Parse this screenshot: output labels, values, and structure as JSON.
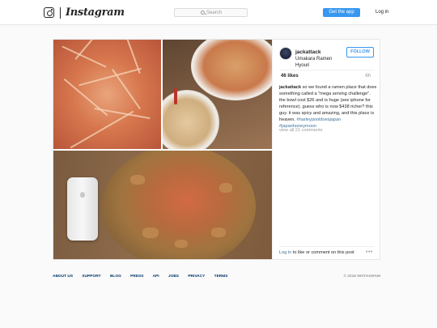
{
  "header": {
    "logo_word": "Instagram",
    "search_placeholder": "Search",
    "get_app_label": "Get the app",
    "login_label": "Log in",
    "accent_color": "#3897f0"
  },
  "post": {
    "username": "jackattack",
    "location": "Umakara Ramen Hyouri",
    "follow_label": "FOLLOW",
    "likes": "46 likes",
    "time_ago": "6h",
    "caption_user": "jackattack",
    "caption_text": "so we found a ramen place that does something called a \"mega serving challenge\". the bowl cost $26 and is huge (see iphone for reference). guess who is now $438 richer? this guy. it was spicy and amazing, and this place is heaven.",
    "hashtag_1": "#harleypooldoesjapan",
    "hashtag_2": "#japanhoneymoon",
    "view_all": "view all 21 comments",
    "login_link": "Log in",
    "login_suffix": " to like or comment on this post",
    "more_icon": "more-dots-icon"
  },
  "footer": {
    "links": [
      "About us",
      "Support",
      "Blog",
      "Press",
      "API",
      "Jobs",
      "Privacy",
      "Terms"
    ],
    "copyright": "© 2016 Instagram"
  }
}
